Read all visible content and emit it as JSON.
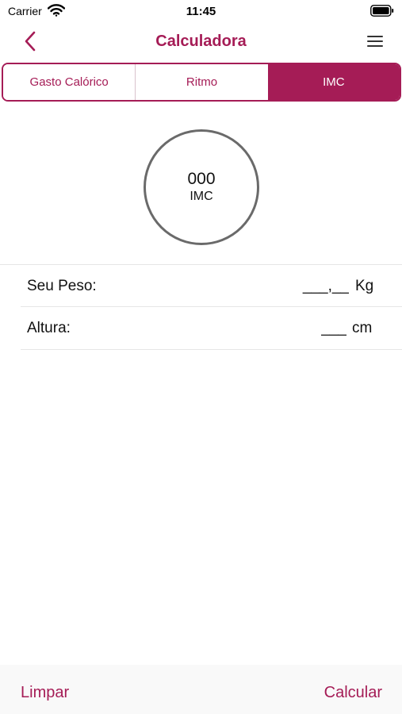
{
  "status_bar": {
    "carrier": "Carrier",
    "time": "11:45",
    "icons": [
      "wifi-icon",
      "battery-icon"
    ]
  },
  "nav": {
    "title": "Calculadora",
    "back_icon": "chevron-left-icon",
    "menu_icon": "hamburger-menu-icon"
  },
  "tabs": [
    {
      "label": "Gasto Calórico",
      "active": false
    },
    {
      "label": "Ritmo",
      "active": false
    },
    {
      "label": "IMC",
      "active": true
    }
  ],
  "result": {
    "value": "000",
    "label": "IMC"
  },
  "form": {
    "weight": {
      "label": "Seu Peso:",
      "value": "",
      "placeholder": "___,__",
      "unit": "Kg"
    },
    "height": {
      "label": "Altura:",
      "value": "",
      "placeholder": "___",
      "unit": "cm"
    }
  },
  "actions": {
    "clear_label": "Limpar",
    "calculate_label": "Calcular"
  },
  "colors": {
    "accent": "#a51c56",
    "circle_border": "#6a6a6a",
    "bottom_bar": "#f9f9f9",
    "divider": "#e6e6e6"
  }
}
